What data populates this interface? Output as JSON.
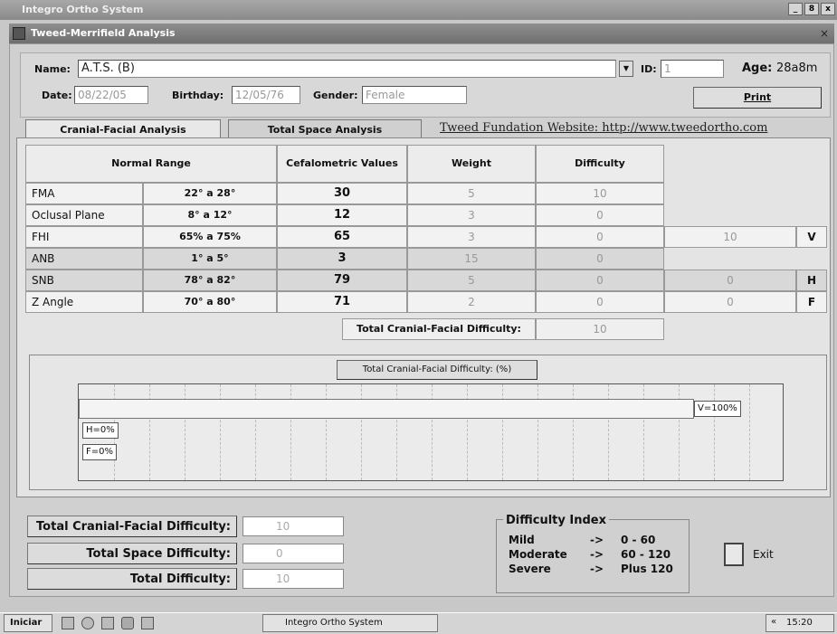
{
  "app_title": "Integro Ortho System",
  "window_buttons": [
    "_",
    "8",
    "x"
  ],
  "child_window": {
    "title": "Tweed-Merrifield Analysis",
    "close": "×"
  },
  "patient": {
    "name_label": "Name:",
    "name": "A.T.S. (B)",
    "id_label": "ID:",
    "id": "1",
    "age_label": "Age:",
    "age": "28a8m",
    "date_label": "Date:",
    "date": "08/22/05",
    "birthday_label": "Birthday:",
    "birthday": "12/05/76",
    "gender_label": "Gender:",
    "gender": "Female",
    "print_label": "Print"
  },
  "tabs": [
    {
      "label": "Cranial-Facial Analysis",
      "active": true
    },
    {
      "label": "Total Space Analysis",
      "active": false
    }
  ],
  "website_link": "Tweed Fundation Website: http://www.tweedortho.com",
  "table": {
    "headers": {
      "normal_range": "Normal Range",
      "cefalometric": "Cefalometric Values",
      "weight": "Weight",
      "difficulty": "Difficulty"
    },
    "rows": [
      {
        "name": "FMA",
        "range": "22° a 28°",
        "value": "30",
        "weight": "5",
        "difficulty": "10",
        "extra": "",
        "letter": ""
      },
      {
        "name": "Oclusal Plane",
        "range": "8° a 12°",
        "value": "12",
        "weight": "3",
        "difficulty": "0",
        "extra": "",
        "letter": ""
      },
      {
        "name": "FHI",
        "range": "65% a 75%",
        "value": "65",
        "weight": "3",
        "difficulty": "0",
        "extra": "10",
        "letter": "V"
      },
      {
        "name": "ANB",
        "range": "1° a 5°",
        "value": "3",
        "weight": "15",
        "difficulty": "0",
        "extra": "",
        "letter": ""
      },
      {
        "name": "SNB",
        "range": "78° a 82°",
        "value": "79",
        "weight": "5",
        "difficulty": "0",
        "extra": "0",
        "letter": "H"
      },
      {
        "name": "Z Angle",
        "range": "70° a 80°",
        "value": "71",
        "weight": "2",
        "difficulty": "0",
        "extra": "0",
        "letter": "F"
      }
    ],
    "total_label": "Total Cranial-Facial Difficulty:",
    "total_value": "10"
  },
  "chart": {
    "title": "Total Cranial-Facial Difficulty: (%)",
    "bars": [
      {
        "label": "V=100%",
        "fraction": 1.0
      },
      {
        "label": "H=0%",
        "fraction": 0
      },
      {
        "label": "F=0%",
        "fraction": 0
      }
    ]
  },
  "summary": [
    {
      "label": "Total Cranial-Facial Difficulty:",
      "value": "10"
    },
    {
      "label": "Total Space Difficulty:",
      "value": "0"
    },
    {
      "label": "Total Difficulty:",
      "value": "10"
    }
  ],
  "difficulty_index": {
    "title": "Difficulty Index",
    "rows": [
      {
        "level": "Mild",
        "arrow": "->",
        "range": "0 - 60"
      },
      {
        "level": "Moderate",
        "arrow": "->",
        "range": "60 - 120"
      },
      {
        "level": "Severe",
        "arrow": "->",
        "range": "Plus 120"
      }
    ]
  },
  "exit_label": "Exit",
  "taskbar": {
    "start": "Iniciar",
    "task": "Integro Ortho System",
    "clock": "15:20",
    "tray_arrow": "«"
  }
}
